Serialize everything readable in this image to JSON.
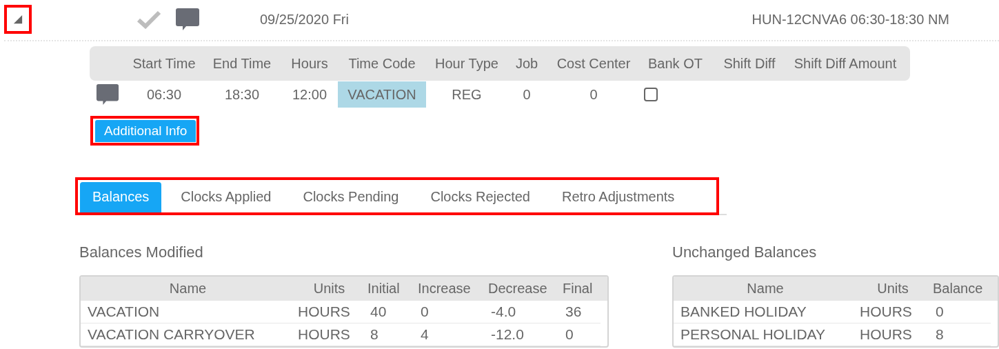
{
  "day_row": {
    "expander": {
      "expanded": true,
      "highlighted": true
    },
    "approved": true,
    "has_comment": true,
    "date": "09/25/2020 Fri",
    "schedule": "HUN-12CNVA6 06:30-18:30 NM"
  },
  "punch_table": {
    "columns": [
      "Start Time",
      "End Time",
      "Hours",
      "Time Code",
      "Hour Type",
      "Job",
      "Cost Center",
      "Bank OT",
      "Shift Diff",
      "Shift Diff Amount"
    ],
    "rows": [
      {
        "has_comment": true,
        "start_time": "06:30",
        "end_time": "18:30",
        "hours": "12:00",
        "time_code": "VACATION",
        "hour_type": "REG",
        "job": "0",
        "cost_center": "0",
        "bank_ot": false
      }
    ]
  },
  "additional_info_button": {
    "label": "Additional Info",
    "highlighted": true
  },
  "tabs_highlighted": true,
  "tabs": [
    {
      "label": "Balances",
      "selected": true
    },
    {
      "label": "Clocks Applied",
      "selected": false
    },
    {
      "label": "Clocks Pending",
      "selected": false
    },
    {
      "label": "Clocks Rejected",
      "selected": false
    },
    {
      "label": "Retro Adjustments",
      "selected": false
    }
  ],
  "balances_modified": {
    "title": "Balances Modified",
    "columns": [
      "Name",
      "Units",
      "Initial",
      "Increase",
      "Decrease",
      "Final"
    ],
    "rows": [
      [
        "VACATION",
        "HOURS",
        "40",
        "0",
        "-4.0",
        "36"
      ],
      [
        "VACATION CARRYOVER",
        "HOURS",
        "8",
        "4",
        "-12.0",
        "0"
      ]
    ]
  },
  "unchanged_balances": {
    "title": "Unchanged Balances",
    "columns": [
      "Name",
      "Units",
      "Balance"
    ],
    "rows": [
      [
        "BANKED HOLIDAY",
        "HOURS",
        "0"
      ],
      [
        "PERSONAL HOLIDAY",
        "HOURS",
        "8"
      ]
    ]
  }
}
